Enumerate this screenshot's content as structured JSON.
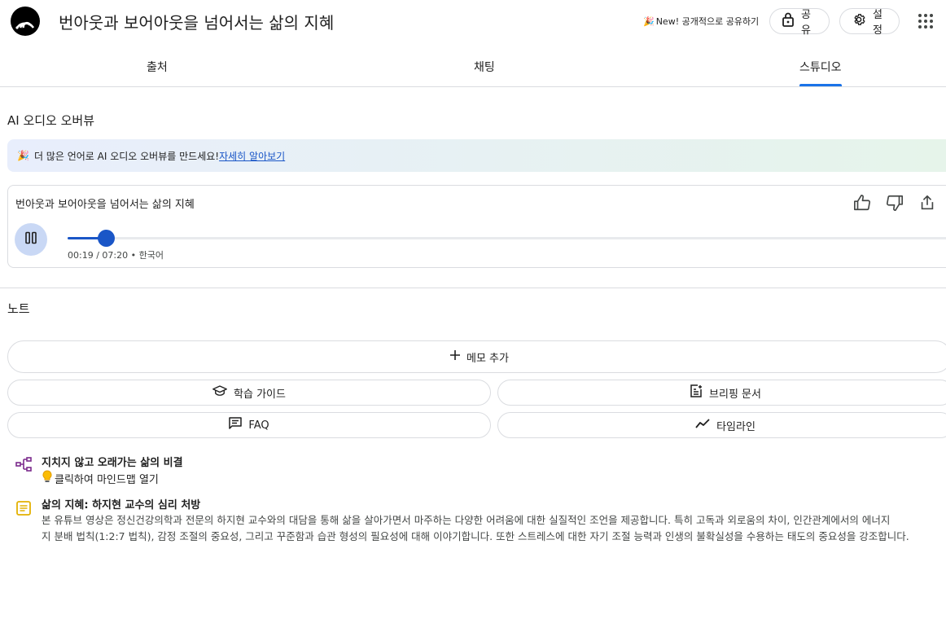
{
  "header": {
    "title": "번아웃과 보어아웃을 넘어서는 삶의 지혜",
    "new_share_label": "New! 공개적으로 공유하기",
    "share_label": "공유",
    "settings_label": "설정"
  },
  "tabs": [
    {
      "label": "출처"
    },
    {
      "label": "채팅"
    },
    {
      "label": "스튜디오"
    }
  ],
  "audio_overview": {
    "section_title": "AI 오디오 오버뷰",
    "banner_text": "더 많은 언어로 AI 오디오 오버뷰를 만드세요!",
    "banner_link": "자세히 알아보기",
    "card_title": "번아웃과 보어아웃을 넘어서는 삶의 지혜",
    "time_text": "00:19 / 07:20 • 한국어",
    "progress_fraction": 0.0432
  },
  "notes": {
    "section_title": "노트",
    "add_memo_label": "메모 추가",
    "study_guide_label": "학습 가이드",
    "briefing_label": "브리핑 문서",
    "faq_label": "FAQ",
    "timeline_label": "타임라인",
    "items": [
      {
        "title": "지치지 않고 오래가는 삶의 비결",
        "subtitle": "클릭하여 마인드맵 열기",
        "icon": "mindmap-icon"
      },
      {
        "title": "삶의 지혜: 하지현 교수의 심리 처방",
        "body_line1": "본 유튜브 영상은 정신건강의학과 전문의 하지현 교수와의 대담을 통해 삶을 살아가면서 마주하는 다양한 어려움에 대한 실질적인 조언을 제공합니다. 특히 고독과 외로움의 차이, 인간관계에서의 에너지",
        "body_line2": "지 분배 법칙(1:2:7 법칙), 감정 조절의 중요성, 그리고 꾸준함과 습관 형성의 필요성에 대해 이야기합니다. 또한 스트레스에 대한 자기 조절 능력과 인생의 불확실성을 수용하는 태도의 중요성을 강조합니다.",
        "icon": "note-icon"
      }
    ]
  },
  "colors": {
    "accent": "#1a56c7",
    "tab_underline": "#1a73e8",
    "mindmap_icon": "#7b2a8c",
    "note_icon": "#e3b100"
  }
}
